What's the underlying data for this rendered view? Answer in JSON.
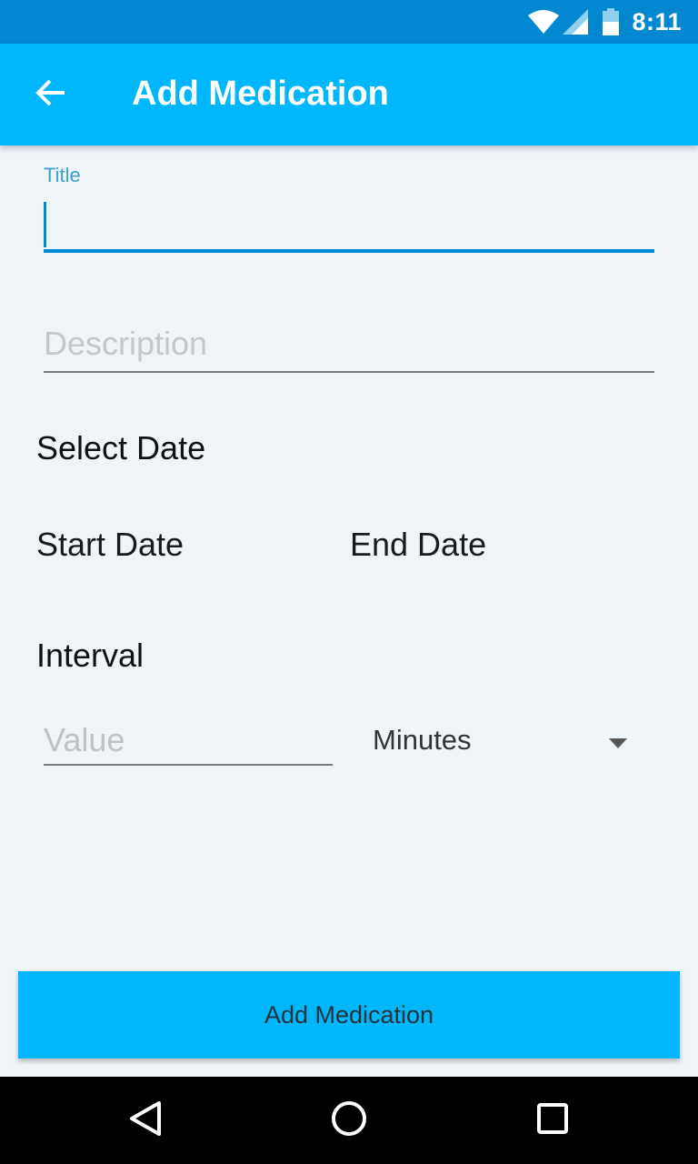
{
  "status_bar": {
    "time": "8:11",
    "icons": [
      "wifi-icon",
      "signal-icon",
      "battery-icon"
    ]
  },
  "app_bar": {
    "title": "Add Medication",
    "back_icon": "arrow-back-icon"
  },
  "form": {
    "title_label": "Title",
    "title_value": "",
    "description_placeholder": "Description",
    "select_date_heading": "Select Date",
    "start_date_label": "Start Date",
    "end_date_label": "End Date",
    "interval_heading": "Interval",
    "value_placeholder": "Value",
    "unit_selected": "Minutes"
  },
  "submit_button": {
    "label": "Add Medication"
  },
  "colors": {
    "primary": "#00b6fc",
    "primary_dark": "#0288d1",
    "background": "#eff4f9"
  },
  "nav_bar": {
    "icons": [
      "back-triangle-icon",
      "home-circle-icon",
      "recents-square-icon"
    ]
  }
}
